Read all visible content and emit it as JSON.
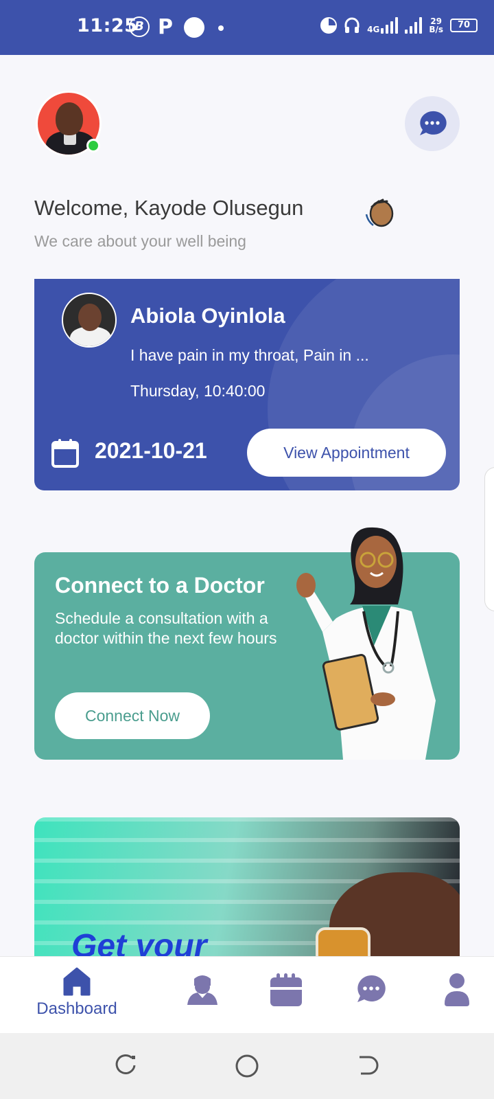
{
  "status_bar": {
    "time": "11:25",
    "b_badge": "B",
    "p_badge": "P",
    "net_label_top": "4G",
    "speed_value": "29",
    "speed_unit": "B/s",
    "battery": "70"
  },
  "header": {
    "welcome": "Welcome, Kayode Olusegun",
    "tagline": "We care about your well being",
    "avatar_online": true
  },
  "appointment": {
    "doctor_name": "Abiola Oyinlola",
    "note": "I have pain in my throat, Pain in ...",
    "time": "Thursday, 10:40:00",
    "date": "2021-10-21",
    "button_label": "View Appointment"
  },
  "connect": {
    "title": "Connect to a Doctor",
    "description": "Schedule a consultation with a doctor within the next few hours",
    "button_label": "Connect Now"
  },
  "promo": {
    "title": "Get your"
  },
  "bottom_nav": {
    "items": [
      {
        "label": "Dashboard",
        "icon": "home-icon",
        "active": true
      },
      {
        "label": "",
        "icon": "doctor-icon",
        "active": false
      },
      {
        "label": "",
        "icon": "calendar-icon",
        "active": false
      },
      {
        "label": "",
        "icon": "chat-icon",
        "active": false
      },
      {
        "label": "",
        "icon": "profile-icon",
        "active": false
      }
    ]
  },
  "colors": {
    "primary": "#3d52ab",
    "teal": "#5bafa0",
    "nav_inactive": "#7c76ad",
    "online": "#2ecc40"
  }
}
